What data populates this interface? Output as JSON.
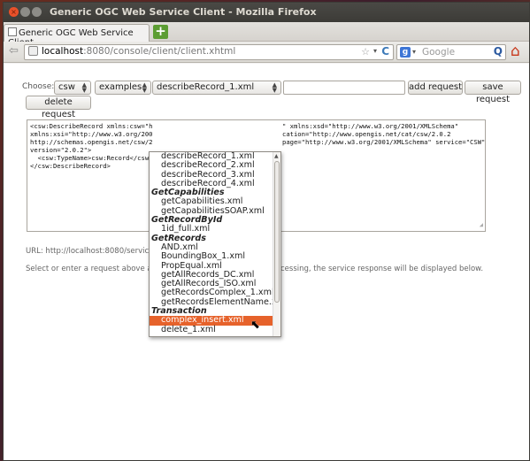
{
  "window": {
    "title": "Generic OGC Web Service Client - Mozilla Firefox",
    "close_glyph": "×",
    "min_glyph": "",
    "max_glyph": ""
  },
  "tab": {
    "label": "Generic OGC Web Service Client",
    "new_tab_glyph": "+"
  },
  "nav": {
    "back_glyph": "⇦",
    "url_host": "localhost",
    "url_path": ":8080/console/client/client.xhtml",
    "star_glyph": "☆",
    "drop_glyph": "▾",
    "reload_glyph": "C",
    "search_engine_glyph": "g",
    "search_placeholder": "Google",
    "search_go_glyph": "Q",
    "home_glyph": "⌂"
  },
  "form": {
    "choose_label": "Choose:",
    "service": "csw",
    "category": "examples",
    "request": "describeRecord_1.xml",
    "add_request": "add request",
    "save_request": "save request",
    "delete_request": "delete request"
  },
  "editor": {
    "lines_left": [
      "<csw:DescribeRecord xmlns:csw=\"h",
      "xmlns:xsi=\"http://www.w3.org/200",
      "http://schemas.opengis.net/csw/2",
      "version=\"2.0.2\">",
      "  <csw:TypeName>csw:Record</csw:",
      "</csw:DescribeRecord>"
    ],
    "lines_right": [
      "\" xmlns:xsd=\"http://www.w3.org/2001/XMLSchema\"",
      "cation=\"http://www.opengis.net/cat/csw/2.0.2",
      "page=\"http://www.w3.org/2001/XMLSchema\" service=\"CSW\""
    ]
  },
  "status": {
    "url_text": "URL: http://localhost:8080/servic",
    "help_left": "Select or enter a request above a",
    "help_right": "cessing, the service response will be displayed below."
  },
  "dropdown": {
    "entries": [
      {
        "kind": "item",
        "label": "describeRecord_1.xml"
      },
      {
        "kind": "item",
        "label": "describeRecord_2.xml"
      },
      {
        "kind": "item",
        "label": "describeRecord_3.xml"
      },
      {
        "kind": "item",
        "label": "describeRecord_4.xml"
      },
      {
        "kind": "group",
        "label": "GetCapabilities"
      },
      {
        "kind": "item",
        "label": "getCapabilities.xml"
      },
      {
        "kind": "item",
        "label": "getCapabilitiesSOAP.xml"
      },
      {
        "kind": "group",
        "label": "GetRecordById"
      },
      {
        "kind": "item",
        "label": "1id_full.xml"
      },
      {
        "kind": "group",
        "label": "GetRecords"
      },
      {
        "kind": "item",
        "label": "AND.xml"
      },
      {
        "kind": "item",
        "label": "BoundingBox_1.xml"
      },
      {
        "kind": "item",
        "label": "PropEqual.xml"
      },
      {
        "kind": "item",
        "label": "getAllRecords_DC.xml"
      },
      {
        "kind": "item",
        "label": "getAllRecords_ISO.xml"
      },
      {
        "kind": "item",
        "label": "getRecordsComplex_1.xml"
      },
      {
        "kind": "item",
        "label": "getRecordsElementName.xml"
      },
      {
        "kind": "group",
        "label": "Transaction"
      },
      {
        "kind": "item",
        "label": "complex_insert.xml",
        "highlighted": true
      },
      {
        "kind": "item",
        "label": "delete_1.xml"
      }
    ]
  },
  "colors": {
    "highlight": "#e6622b",
    "window_title_bar": "#3c3b37"
  }
}
